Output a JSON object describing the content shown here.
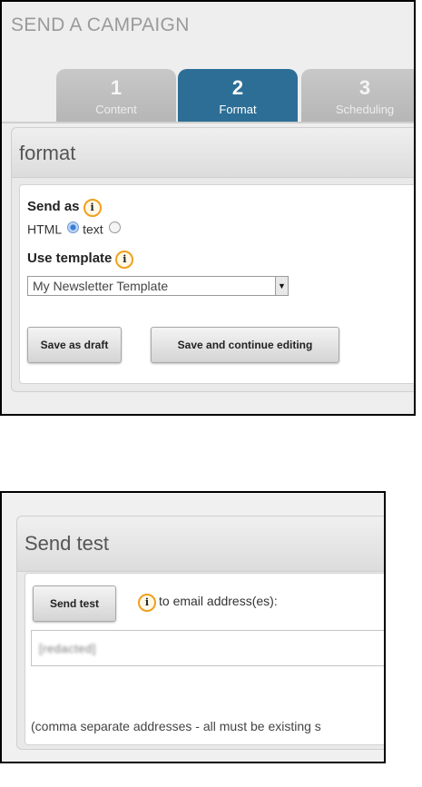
{
  "campaign": {
    "title": "SEND A CAMPAIGN",
    "tabs": [
      {
        "number": "1",
        "label": "Content",
        "active": false
      },
      {
        "number": "2",
        "label": "Format",
        "active": true
      },
      {
        "number": "3",
        "label": "Scheduling",
        "active": false
      }
    ],
    "section_title": "format",
    "send_as": {
      "label": "Send as",
      "options": [
        {
          "label": "HTML",
          "checked": true
        },
        {
          "label": "text",
          "checked": false
        }
      ]
    },
    "template": {
      "label": "Use template",
      "selected": "My Newsletter Template"
    },
    "buttons": {
      "save_draft": "Save as draft",
      "save_continue": "Save and continue editing"
    }
  },
  "send_test": {
    "title": "Send test",
    "button_label": "Send test",
    "to_label": "to email address(es):",
    "email_value": "[redacted]",
    "hint": "(comma separate addresses - all must be existing s"
  },
  "colors": {
    "active_tab": "#2c6e96",
    "inactive_tab": "#bdbdbd",
    "info_icon_ring": "#f0a020"
  },
  "icons": [
    "info-icon",
    "radio-selected",
    "radio-unselected",
    "dropdown-arrow-icon"
  ]
}
